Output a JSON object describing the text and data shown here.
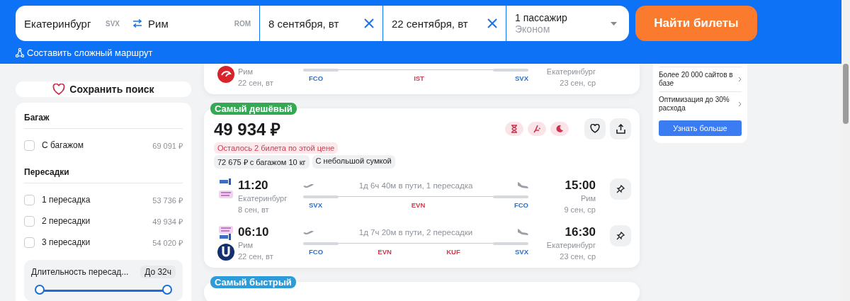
{
  "search": {
    "from": {
      "value": "Екатеринбург",
      "code": "SVX"
    },
    "to": {
      "value": "Рим",
      "code": "ROM"
    },
    "dates": [
      {
        "value": "8 сентября, вт"
      },
      {
        "value": "22 сентября, вт"
      }
    ],
    "passengers": {
      "count": "1 пассажир",
      "class": "Эконом"
    },
    "submit": "Найти билеты",
    "complex_route": "Составить сложный маршрут"
  },
  "sidebar": {
    "save_search": "Сохранить поиск",
    "filters": [
      {
        "title": "Багаж",
        "options": [
          {
            "label": "С багажом",
            "price": "69 091 ₽",
            "checked": false
          }
        ]
      },
      {
        "title": "Пересадки",
        "options": [
          {
            "label": "1 пересадка",
            "price": "53 736 ₽",
            "checked": false
          },
          {
            "label": "2 пересадки",
            "price": "49 934 ₽",
            "checked": false
          },
          {
            "label": "3 пересадки",
            "price": "54 020 ₽",
            "checked": false
          }
        ]
      }
    ],
    "duration": {
      "label": "Длительность пересад...",
      "value": "До 32ч",
      "level": 1
    }
  },
  "results": [
    {
      "legs": [
        {
          "origin": {
            "city": "Рим",
            "date": "22 сен, вт"
          },
          "destination": {
            "city": "Екатеринбург",
            "date": "23 сен, ср"
          },
          "stops": [
            {
              "code": "FCO",
              "kind": "endpoint"
            },
            {
              "code": "IST",
              "kind": "transfer"
            },
            {
              "code": "SVX",
              "kind": "endpoint"
            }
          ]
        }
      ]
    },
    {
      "badge": {
        "label": "Самый дешёвый",
        "color": "#34a853"
      },
      "price": "49 934 ₽",
      "warning": "Осталось 2 билета по этой цене",
      "tags": [
        "72 675 ₽ с багажом 10 кг",
        "С небольшой сумкой"
      ],
      "legs": [
        {
          "origin": {
            "time": "11:20",
            "city": "Екатеринбург",
            "date": "8 сен, вт"
          },
          "destination": {
            "time": "15:00",
            "city": "Рим",
            "date": "9 сен, ср"
          },
          "duration": "1д 6ч 40м в пути, 1 пересадка",
          "stops": [
            {
              "code": "SVX",
              "kind": "endpoint"
            },
            {
              "code": "EVN",
              "kind": "transfer"
            },
            {
              "code": "FCO",
              "kind": "endpoint"
            }
          ]
        },
        {
          "origin": {
            "time": "06:10",
            "city": "Рим",
            "date": "22 сен, вт"
          },
          "destination": {
            "time": "16:30",
            "city": "Екатеринбург",
            "date": "23 сен, ср"
          },
          "duration": "1д 7ч 20м в пути, 2 пересадки",
          "stops": [
            {
              "code": "FCO",
              "kind": "endpoint"
            },
            {
              "code": "EVN",
              "kind": "transfer"
            },
            {
              "code": "KUF",
              "kind": "transfer"
            },
            {
              "code": "SVX",
              "kind": "endpoint"
            }
          ]
        }
      ]
    },
    {
      "badge": {
        "label": "Самый быстрый",
        "color": "#2b9bd9"
      }
    }
  ],
  "promo": {
    "items": [
      "Более 20 000 сайтов в базе",
      "Оптимизация до 30% расхода"
    ],
    "button": "Узнать больше"
  }
}
